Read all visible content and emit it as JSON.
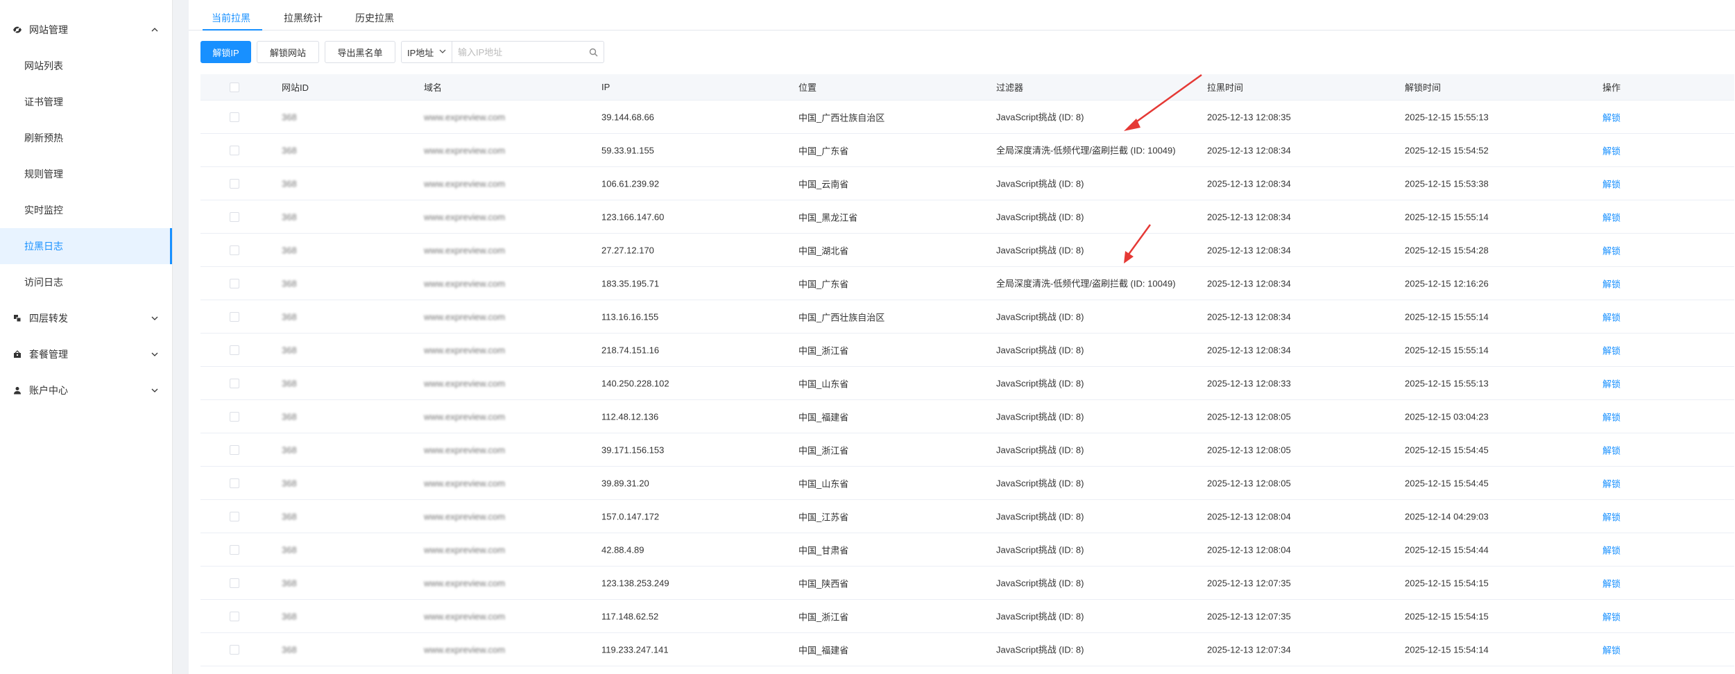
{
  "sidebar": {
    "groups": [
      {
        "label": "网站管理",
        "expanded": true,
        "icon": "eye-off-icon"
      },
      {
        "label": "四层转发",
        "expanded": false,
        "icon": "layers-icon"
      },
      {
        "label": "套餐管理",
        "expanded": false,
        "icon": "package-icon"
      },
      {
        "label": "账户中心",
        "expanded": false,
        "icon": "user-icon"
      }
    ],
    "items": [
      {
        "label": "网站列表"
      },
      {
        "label": "证书管理"
      },
      {
        "label": "刷新预热"
      },
      {
        "label": "规则管理"
      },
      {
        "label": "实时监控"
      },
      {
        "label": "拉黑日志",
        "active": true
      },
      {
        "label": "访问日志"
      }
    ]
  },
  "tabs": [
    {
      "label": "当前拉黑",
      "active": true
    },
    {
      "label": "拉黑统计"
    },
    {
      "label": "历史拉黑"
    }
  ],
  "toolbar": {
    "unlock_ip": "解锁IP",
    "unlock_site": "解锁网站",
    "export": "导出黑名单",
    "select_value": "IP地址",
    "search_placeholder": "输入IP地址"
  },
  "table": {
    "headers": {
      "site_id": "网站ID",
      "domain": "域名",
      "ip": "IP",
      "location": "位置",
      "filter": "过滤器",
      "block_time": "拉黑时间",
      "unlock_time": "解锁时间",
      "action": "操作"
    },
    "rows": [
      {
        "site_id": "368",
        "domain": "www.expreview.com",
        "ip": "39.144.68.66",
        "location": "中国_广西壮族自治区",
        "filter": "JavaScript挑战 (ID: 8)",
        "block_time": "2025-12-13 12:08:35",
        "unlock_time": "2025-12-15 15:55:13",
        "action": "解锁"
      },
      {
        "site_id": "368",
        "domain": "www.expreview.com",
        "ip": "59.33.91.155",
        "location": "中国_广东省",
        "filter": "全局深度清洗-低频代理/盗刷拦截 (ID: 10049)",
        "block_time": "2025-12-13 12:08:34",
        "unlock_time": "2025-12-15 15:54:52",
        "action": "解锁"
      },
      {
        "site_id": "368",
        "domain": "www.expreview.com",
        "ip": "106.61.239.92",
        "location": "中国_云南省",
        "filter": "JavaScript挑战 (ID: 8)",
        "block_time": "2025-12-13 12:08:34",
        "unlock_time": "2025-12-15 15:53:38",
        "action": "解锁"
      },
      {
        "site_id": "368",
        "domain": "www.expreview.com",
        "ip": "123.166.147.60",
        "location": "中国_黑龙江省",
        "filter": "JavaScript挑战 (ID: 8)",
        "block_time": "2025-12-13 12:08:34",
        "unlock_time": "2025-12-15 15:55:14",
        "action": "解锁"
      },
      {
        "site_id": "368",
        "domain": "www.expreview.com",
        "ip": "27.27.12.170",
        "location": "中国_湖北省",
        "filter": "JavaScript挑战 (ID: 8)",
        "block_time": "2025-12-13 12:08:34",
        "unlock_time": "2025-12-15 15:54:28",
        "action": "解锁"
      },
      {
        "site_id": "368",
        "domain": "www.expreview.com",
        "ip": "183.35.195.71",
        "location": "中国_广东省",
        "filter": "全局深度清洗-低频代理/盗刷拦截 (ID: 10049)",
        "block_time": "2025-12-13 12:08:34",
        "unlock_time": "2025-12-15 12:16:26",
        "action": "解锁"
      },
      {
        "site_id": "368",
        "domain": "www.expreview.com",
        "ip": "113.16.16.155",
        "location": "中国_广西壮族自治区",
        "filter": "JavaScript挑战 (ID: 8)",
        "block_time": "2025-12-13 12:08:34",
        "unlock_time": "2025-12-15 15:55:14",
        "action": "解锁"
      },
      {
        "site_id": "368",
        "domain": "www.expreview.com",
        "ip": "218.74.151.16",
        "location": "中国_浙江省",
        "filter": "JavaScript挑战 (ID: 8)",
        "block_time": "2025-12-13 12:08:34",
        "unlock_time": "2025-12-15 15:55:14",
        "action": "解锁"
      },
      {
        "site_id": "368",
        "domain": "www.expreview.com",
        "ip": "140.250.228.102",
        "location": "中国_山东省",
        "filter": "JavaScript挑战 (ID: 8)",
        "block_time": "2025-12-13 12:08:33",
        "unlock_time": "2025-12-15 15:55:13",
        "action": "解锁"
      },
      {
        "site_id": "368",
        "domain": "www.expreview.com",
        "ip": "112.48.12.136",
        "location": "中国_福建省",
        "filter": "JavaScript挑战 (ID: 8)",
        "block_time": "2025-12-13 12:08:05",
        "unlock_time": "2025-12-15 03:04:23",
        "action": "解锁"
      },
      {
        "site_id": "368",
        "domain": "www.expreview.com",
        "ip": "39.171.156.153",
        "location": "中国_浙江省",
        "filter": "JavaScript挑战 (ID: 8)",
        "block_time": "2025-12-13 12:08:05",
        "unlock_time": "2025-12-15 15:54:45",
        "action": "解锁"
      },
      {
        "site_id": "368",
        "domain": "www.expreview.com",
        "ip": "39.89.31.20",
        "location": "中国_山东省",
        "filter": "JavaScript挑战 (ID: 8)",
        "block_time": "2025-12-13 12:08:05",
        "unlock_time": "2025-12-15 15:54:45",
        "action": "解锁"
      },
      {
        "site_id": "368",
        "domain": "www.expreview.com",
        "ip": "157.0.147.172",
        "location": "中国_江苏省",
        "filter": "JavaScript挑战 (ID: 8)",
        "block_time": "2025-12-13 12:08:04",
        "unlock_time": "2025-12-14 04:29:03",
        "action": "解锁"
      },
      {
        "site_id": "368",
        "domain": "www.expreview.com",
        "ip": "42.88.4.89",
        "location": "中国_甘肃省",
        "filter": "JavaScript挑战 (ID: 8)",
        "block_time": "2025-12-13 12:08:04",
        "unlock_time": "2025-12-15 15:54:44",
        "action": "解锁"
      },
      {
        "site_id": "368",
        "domain": "www.expreview.com",
        "ip": "123.138.253.249",
        "location": "中国_陕西省",
        "filter": "JavaScript挑战 (ID: 8)",
        "block_time": "2025-12-13 12:07:35",
        "unlock_time": "2025-12-15 15:54:15",
        "action": "解锁"
      },
      {
        "site_id": "368",
        "domain": "www.expreview.com",
        "ip": "117.148.62.52",
        "location": "中国_浙江省",
        "filter": "JavaScript挑战 (ID: 8)",
        "block_time": "2025-12-13 12:07:35",
        "unlock_time": "2025-12-15 15:54:15",
        "action": "解锁"
      },
      {
        "site_id": "368",
        "domain": "www.expreview.com",
        "ip": "119.233.247.141",
        "location": "中国_福建省",
        "filter": "JavaScript挑战 (ID: 8)",
        "block_time": "2025-12-13 12:07:34",
        "unlock_time": "2025-12-15 15:54:14",
        "action": "解锁"
      }
    ]
  },
  "colors": {
    "primary": "#1890ff",
    "annotation_arrow": "#e53935"
  }
}
